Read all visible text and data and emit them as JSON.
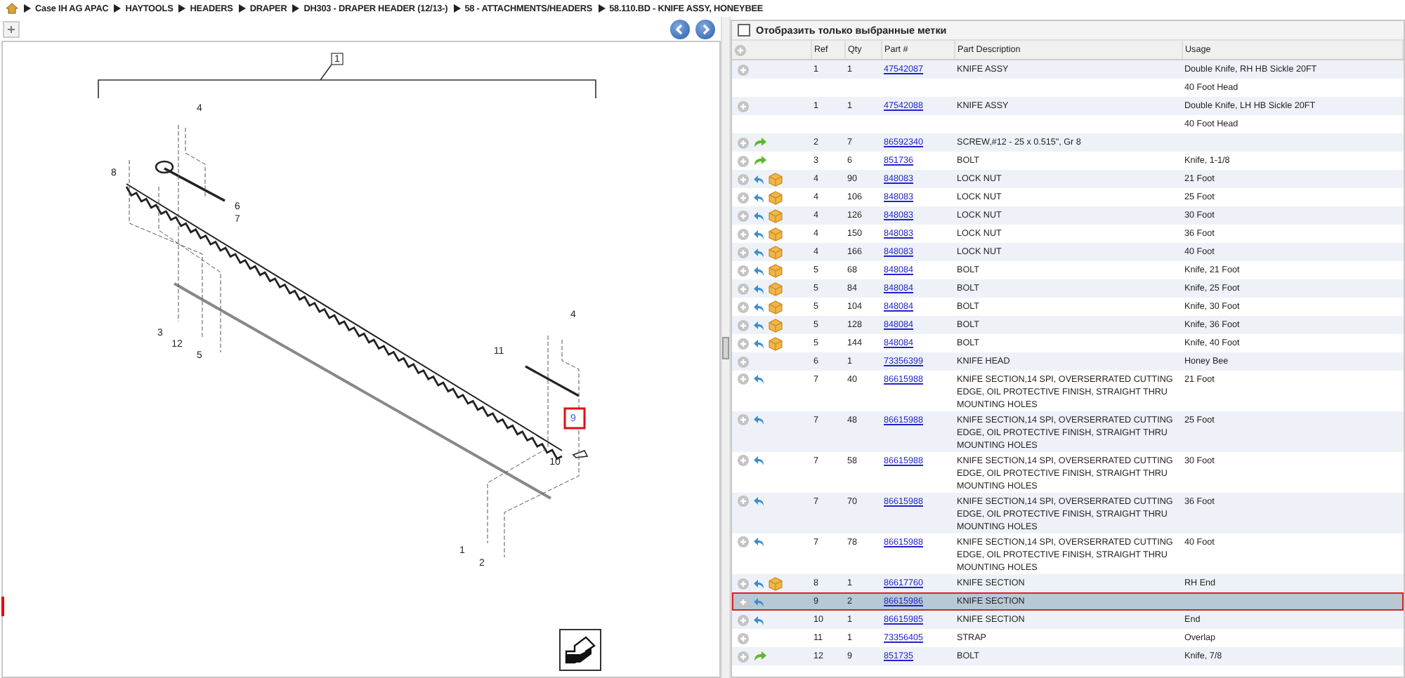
{
  "breadcrumb": [
    "Case IH AG APAC",
    "HAYTOOLS",
    "HEADERS",
    "DRAPER",
    "DH303 - DRAPER HEADER (12/13-)",
    "58 - ATTACHMENTS/HEADERS",
    "58.110.BD - KNIFE ASSY, HONEYBEE"
  ],
  "diagram": {
    "callouts": [
      {
        "label": "1",
        "kind": "boxed",
        "selected": false
      },
      {
        "label": "4",
        "kind": "plain",
        "selected": false
      },
      {
        "label": "8",
        "kind": "plain",
        "selected": false
      },
      {
        "label": "6",
        "kind": "plain",
        "selected": false
      },
      {
        "label": "7",
        "kind": "plain",
        "selected": false
      },
      {
        "label": "3",
        "kind": "plain",
        "selected": false
      },
      {
        "label": "12",
        "kind": "plain",
        "selected": false
      },
      {
        "label": "5",
        "kind": "plain",
        "selected": false
      },
      {
        "label": "4",
        "kind": "plain",
        "selected": false
      },
      {
        "label": "11",
        "kind": "plain",
        "selected": false
      },
      {
        "label": "9",
        "kind": "plain",
        "selected": true
      },
      {
        "label": "10",
        "kind": "plain",
        "selected": false
      },
      {
        "label": "1",
        "kind": "plain",
        "selected": false
      },
      {
        "label": "2",
        "kind": "plain",
        "selected": false
      }
    ]
  },
  "filter": {
    "label": "Отобразить только выбранные метки",
    "checked": false
  },
  "table": {
    "columns": [
      "Ref",
      "Qty",
      "Part #",
      "Part Description",
      "Usage"
    ],
    "rows": [
      {
        "kind": "plain",
        "ref": "1",
        "qty": "1",
        "part": "47542087",
        "description": "KNIFE ASSY",
        "usage": "Double Knife, RH HB Sickle 20FT",
        "usage_note": "40 Foot Head",
        "selected": false
      },
      {
        "kind": "plain",
        "ref": "1",
        "qty": "1",
        "part": "47542088",
        "description": "KNIFE ASSY",
        "usage": "Double Knife, LH HB Sickle 20FT",
        "usage_note": "40 Foot Head",
        "selected": false
      },
      {
        "kind": "forward",
        "ref": "2",
        "qty": "7",
        "part": "86592340",
        "description": "SCREW,#12 - 25 x 0.515\", Gr 8",
        "selected": false
      },
      {
        "kind": "forward",
        "ref": "3",
        "qty": "6",
        "part": "851736",
        "description": "BOLT",
        "usage": "Knife, 1-1/8",
        "selected": false
      },
      {
        "kind": "backbox",
        "ref": "4",
        "qty": "90",
        "part": "848083",
        "description": "LOCK NUT",
        "usage": "21 Foot",
        "selected": false
      },
      {
        "kind": "backbox",
        "ref": "4",
        "qty": "106",
        "part": "848083",
        "description": "LOCK NUT",
        "usage": "25 Foot",
        "selected": false
      },
      {
        "kind": "backbox",
        "ref": "4",
        "qty": "126",
        "part": "848083",
        "description": "LOCK NUT",
        "usage": "30 Foot",
        "selected": false
      },
      {
        "kind": "backbox",
        "ref": "4",
        "qty": "150",
        "part": "848083",
        "description": "LOCK NUT",
        "usage": "36 Foot",
        "selected": false
      },
      {
        "kind": "backbox",
        "ref": "4",
        "qty": "166",
        "part": "848083",
        "description": "LOCK NUT",
        "usage": "40 Foot",
        "selected": false
      },
      {
        "kind": "backbox",
        "ref": "5",
        "qty": "68",
        "part": "848084",
        "description": "BOLT",
        "usage": "Knife, 21 Foot",
        "selected": false
      },
      {
        "kind": "backbox",
        "ref": "5",
        "qty": "84",
        "part": "848084",
        "description": "BOLT",
        "usage": "Knife, 25 Foot",
        "selected": false
      },
      {
        "kind": "backbox",
        "ref": "5",
        "qty": "104",
        "part": "848084",
        "description": "BOLT",
        "usage": "Knife, 30 Foot",
        "selected": false
      },
      {
        "kind": "backbox",
        "ref": "5",
        "qty": "128",
        "part": "848084",
        "description": "BOLT",
        "usage": "Knife, 36 Foot",
        "selected": false
      },
      {
        "kind": "backbox",
        "ref": "5",
        "qty": "144",
        "part": "848084",
        "description": "BOLT",
        "usage": "Knife, 40 Foot",
        "selected": false
      },
      {
        "kind": "plain",
        "ref": "6",
        "qty": "1",
        "part": "73356399",
        "description": "KNIFE HEAD",
        "usage": "Honey Bee",
        "selected": false
      },
      {
        "kind": "back",
        "ref": "7",
        "qty": "40",
        "part": "86615988",
        "description": "KNIFE SECTION,14 SPI, OVERSERRATED CUTTING EDGE, OIL PROTECTIVE FINISH, STRAIGHT THRU MOUNTING HOLES",
        "usage": "21 Foot",
        "selected": false
      },
      {
        "kind": "back",
        "ref": "7",
        "qty": "48",
        "part": "86615988",
        "description": "KNIFE SECTION,14 SPI, OVERSERRATED CUTTING EDGE, OIL PROTECTIVE FINISH, STRAIGHT THRU MOUNTING HOLES",
        "usage": "25 Foot",
        "selected": false
      },
      {
        "kind": "back",
        "ref": "7",
        "qty": "58",
        "part": "86615988",
        "description": "KNIFE SECTION,14 SPI, OVERSERRATED CUTTING EDGE, OIL PROTECTIVE FINISH, STRAIGHT THRU MOUNTING HOLES",
        "usage": "30 Foot",
        "selected": false
      },
      {
        "kind": "back",
        "ref": "7",
        "qty": "70",
        "part": "86615988",
        "description": "KNIFE SECTION,14 SPI, OVERSERRATED CUTTING EDGE, OIL PROTECTIVE FINISH, STRAIGHT THRU MOUNTING HOLES",
        "usage": "36 Foot",
        "selected": false
      },
      {
        "kind": "back",
        "ref": "7",
        "qty": "78",
        "part": "86615988",
        "description": "KNIFE SECTION,14 SPI, OVERSERRATED CUTTING EDGE, OIL PROTECTIVE FINISH, STRAIGHT THRU MOUNTING HOLES",
        "usage": "40 Foot",
        "selected": false
      },
      {
        "kind": "backbox",
        "ref": "8",
        "qty": "1",
        "part": "86617760",
        "description": "KNIFE SECTION",
        "usage": "RH End",
        "selected": false
      },
      {
        "kind": "back",
        "ref": "9",
        "qty": "2",
        "part": "86615986",
        "description": "KNIFE SECTION",
        "selected": true
      },
      {
        "kind": "back",
        "ref": "10",
        "qty": "1",
        "part": "86615985",
        "description": "KNIFE SECTION",
        "usage": "End",
        "selected": false
      },
      {
        "kind": "plain",
        "ref": "11",
        "qty": "1",
        "part": "73356405",
        "description": "STRAP",
        "usage": "Overlap",
        "selected": false
      },
      {
        "kind": "forward",
        "ref": "12",
        "qty": "9",
        "part": "851735",
        "description": "BOLT",
        "usage": "Knife, 7/8",
        "selected": false
      }
    ]
  }
}
